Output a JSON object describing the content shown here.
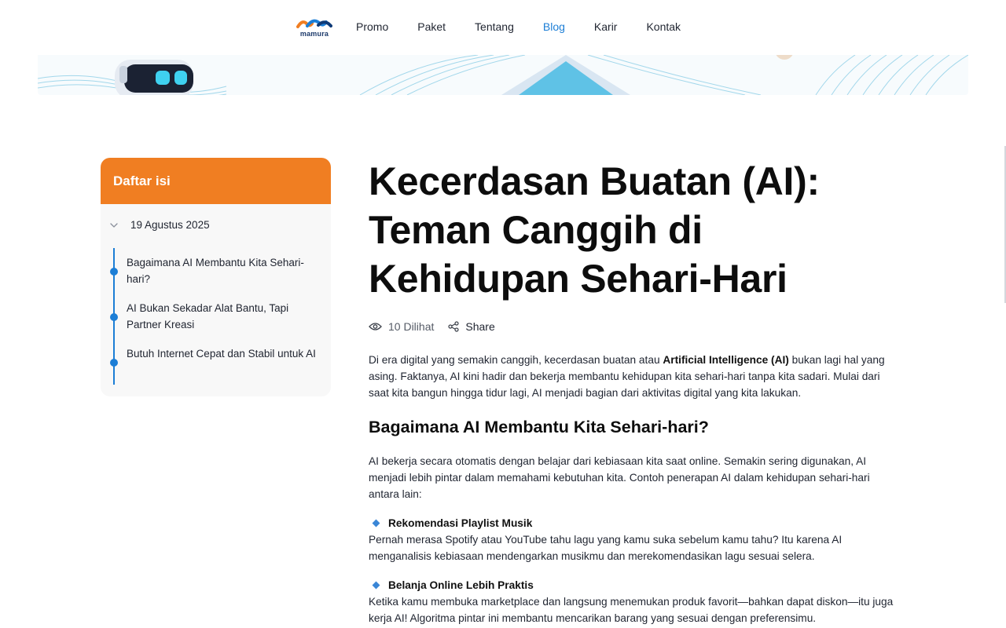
{
  "header": {
    "logo_text": "mamura",
    "nav": [
      {
        "label": "Promo",
        "active": false
      },
      {
        "label": "Paket",
        "active": false
      },
      {
        "label": "Tentang",
        "active": false
      },
      {
        "label": "Blog",
        "active": true
      },
      {
        "label": "Karir",
        "active": false
      },
      {
        "label": "Kontak",
        "active": false
      }
    ]
  },
  "toc": {
    "title": "Daftar isi",
    "date": "19 Agustus 2025",
    "items": [
      "Bagaimana AI Membantu Kita Sehari-hari?",
      "AI Bukan Sekadar Alat Bantu, Tapi Partner Kreasi",
      "Butuh Internet Cepat dan Stabil untuk AI"
    ]
  },
  "article": {
    "title_lines": [
      "Kecerdasan Buatan (AI):",
      "Teman Canggih di",
      "Kehidupan Sehari-Hari"
    ],
    "views": "10 Dilihat",
    "share": "Share",
    "intro_before": "Di era digital yang semakin canggih, kecerdasan buatan atau ",
    "intro_bold": "Artificial Intelligence (AI)",
    "intro_after": " bukan lagi hal yang asing. Faktanya, AI kini hadir dan bekerja membantu kehidupan kita sehari-hari tanpa kita sadari. Mulai dari saat kita bangun hingga tidur lagi, AI menjadi bagian dari aktivitas digital yang kita lakukan.",
    "heading": "Bagaimana AI Membantu Kita Sehari-hari?",
    "para2": "AI bekerja secara otomatis dengan belajar dari kebiasaan kita saat online. Semakin sering digunakan, AI menjadi lebih pintar dalam memahami kebutuhan kita. Contoh penerapan AI dalam kehidupan sehari-hari antara lain:",
    "points": [
      {
        "title": "Rekomendasi Playlist Musik",
        "text": "Pernah merasa Spotify atau YouTube tahu lagu yang kamu suka sebelum kamu tahu? Itu karena AI menganalisis kebiasaan mendengarkan musikmu dan merekomendasikan lagu sesuai selera."
      },
      {
        "title": "Belanja Online Lebih Praktis",
        "text": "Ketika kamu membuka marketplace dan langsung menemukan produk favorit—bahkan dapat diskon—itu juga kerja AI! Algoritma pintar ini membantu mencarikan barang yang sesuai dengan preferensimu."
      }
    ]
  },
  "colors": {
    "accent_orange": "#f07e22",
    "accent_blue": "#1c7ed6",
    "text_dark": "#0d0d0d"
  }
}
